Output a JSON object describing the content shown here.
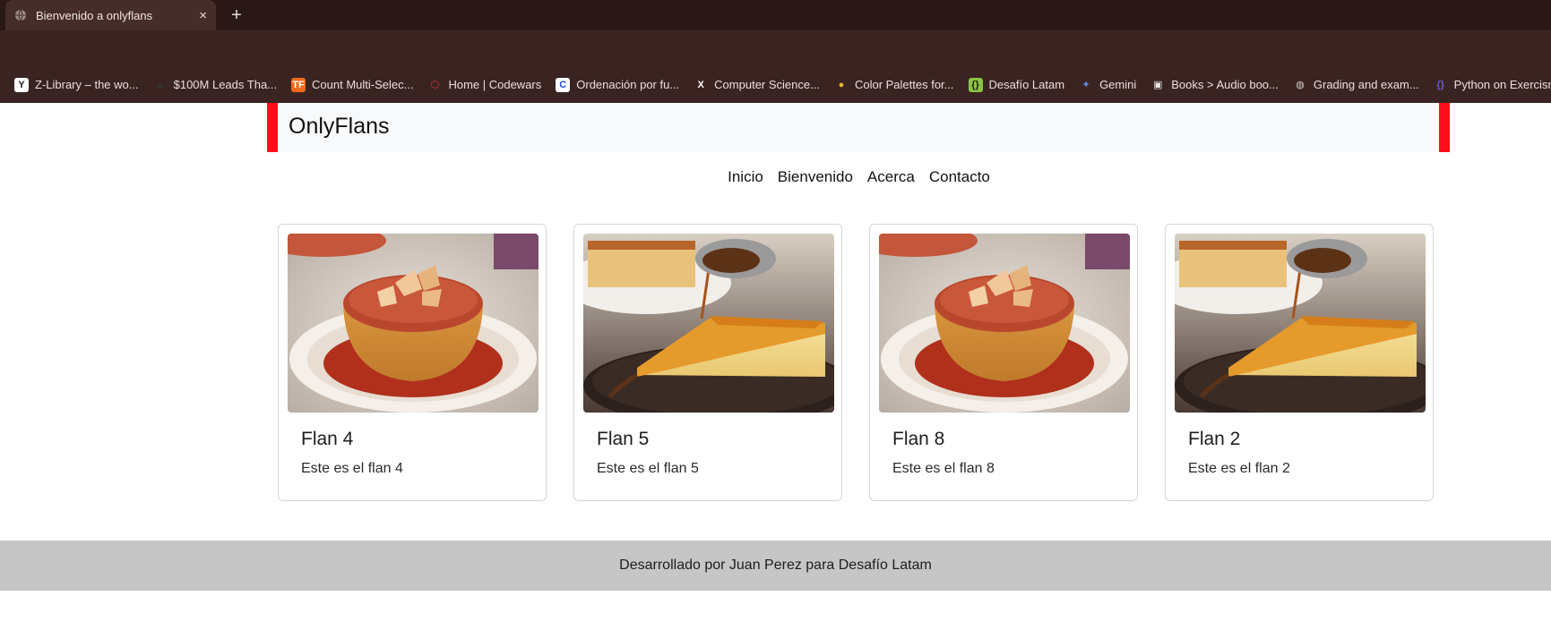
{
  "browser": {
    "tab_title": "Bienvenido a onlyflans",
    "tab_close": "×",
    "new_tab": "+",
    "bookmarks": [
      {
        "label": "Z-Library – the wo...",
        "icon": "z-library-icon",
        "glyph": "Y",
        "color": "#ffffff",
        "fg": "#222222"
      },
      {
        "label": "$100M Leads Tha...",
        "icon": "triangle-icon",
        "glyph": "▲",
        "color": "transparent",
        "fg": "#333333"
      },
      {
        "label": "Count Multi-Selec...",
        "icon": "tf-icon",
        "glyph": "TF",
        "color": "#f26b1d",
        "fg": "#ffffff"
      },
      {
        "label": "Home | Codewars",
        "icon": "codewars-icon",
        "glyph": "⬡",
        "color": "transparent",
        "fg": "#d9393f"
      },
      {
        "label": "Ordenación por fu...",
        "icon": "c-icon",
        "glyph": "C",
        "color": "#ffffff",
        "fg": "#1f4fd8"
      },
      {
        "label": "Computer Science...",
        "icon": "x-icon",
        "glyph": "X",
        "color": "transparent",
        "fg": "#ffffff"
      },
      {
        "label": "Color Palettes for...",
        "icon": "palette-icon",
        "glyph": "●",
        "color": "transparent",
        "fg": "#e5b43a"
      },
      {
        "label": "Desafío Latam",
        "icon": "desafio-icon",
        "glyph": "{}",
        "color": "#8ac43f",
        "fg": "#1d1d1d"
      },
      {
        "label": "Gemini",
        "icon": "gemini-icon",
        "glyph": "✦",
        "color": "transparent",
        "fg": "#5d8cf0"
      },
      {
        "label": "Books > Audio boo...",
        "icon": "books-icon",
        "glyph": "▣",
        "color": "transparent",
        "fg": "#e6e6e6"
      },
      {
        "label": "Grading and exam...",
        "icon": "globe-icon",
        "glyph": "◍",
        "color": "transparent",
        "fg": "#cfcfcf"
      },
      {
        "label": "Python on Exercism",
        "icon": "exercism-icon",
        "glyph": "{}",
        "color": "transparent",
        "fg": "#6b5cd6"
      },
      {
        "label": "",
        "icon": "drive-icon",
        "glyph": "▲",
        "color": "transparent",
        "fg": "#f4b400"
      }
    ]
  },
  "site": {
    "brand": "OnlyFlans",
    "nav": [
      "Inicio",
      "Bienvenido",
      "Acerca",
      "Contacto"
    ],
    "cards": [
      {
        "title": "Flan 4",
        "text": "Este es el flan 4",
        "image": "flan-dome"
      },
      {
        "title": "Flan 5",
        "text": "Este es el flan 5",
        "image": "flan-slice"
      },
      {
        "title": "Flan 8",
        "text": "Este es el flan 8",
        "image": "flan-dome"
      },
      {
        "title": "Flan 2",
        "text": "Este es el flan 2",
        "image": "flan-slice"
      }
    ],
    "footer": "Desarrollado por Juan Perez para Desafío Latam"
  },
  "colors": {
    "header_accent": "#ff0d1a",
    "header_bg": "#f8f9fa",
    "footer_bg": "#c6c6c6",
    "chrome_bg": "#2f1c1a"
  }
}
